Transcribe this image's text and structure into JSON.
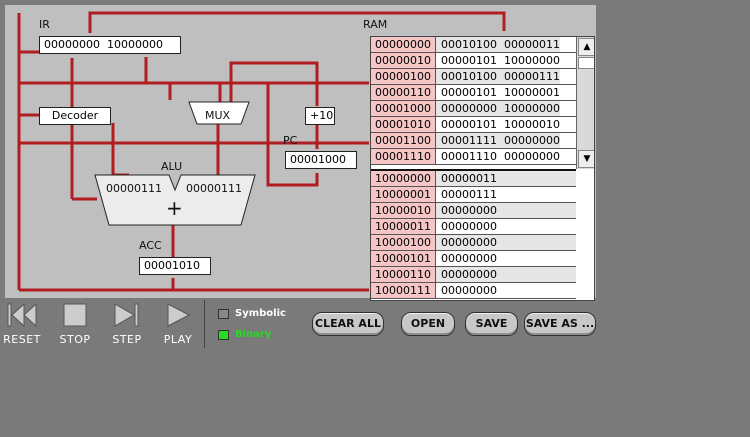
{
  "circuit": {
    "ir_label": "IR",
    "ir_value": "00000000  10000000",
    "ram_label": "RAM",
    "decoder": "Decoder",
    "mux": "MUX",
    "plus10": "+10",
    "pc_label": "PC",
    "pc_value": "00001000",
    "alu_label": "ALU",
    "alu_in1": "00000111",
    "alu_in2": "00000111",
    "alu_op": "+",
    "acc_label": "ACC",
    "acc_value": "00001010"
  },
  "ram": {
    "program_rows": [
      {
        "addr": "00000000",
        "value": "00010100  00000011"
      },
      {
        "addr": "00000010",
        "value": "00000101  10000000"
      },
      {
        "addr": "00000100",
        "value": "00010100  00000111"
      },
      {
        "addr": "00000110",
        "value": "00000101  10000001"
      },
      {
        "addr": "00001000",
        "value": "00000000  10000000"
      },
      {
        "addr": "00001010",
        "value": "00000101  10000010"
      },
      {
        "addr": "00001100",
        "value": "00001111  00000000"
      },
      {
        "addr": "00001110",
        "value": "00001110  00000000"
      }
    ],
    "data_rows": [
      {
        "addr": "10000000",
        "value": "00000011"
      },
      {
        "addr": "10000001",
        "value": "00000111"
      },
      {
        "addr": "10000010",
        "value": "00000000"
      },
      {
        "addr": "10000011",
        "value": "00000000"
      },
      {
        "addr": "10000100",
        "value": "00000000"
      },
      {
        "addr": "10000101",
        "value": "00000000"
      },
      {
        "addr": "10000110",
        "value": "00000000"
      },
      {
        "addr": "10000111",
        "value": "00000000"
      }
    ],
    "scroll_up": "▲",
    "scroll_down": "▼"
  },
  "controls": {
    "reset": "RESET",
    "stop": "STOP",
    "step": "STEP",
    "play": "PLAY"
  },
  "mode": {
    "symbolic": "Symbolic",
    "binary": "Binary",
    "selected": "binary",
    "active_color": "#22dd22",
    "inactive_color": "#ffffff"
  },
  "buttons": {
    "clear_all": "CLEAR ALL",
    "open": "OPEN",
    "save": "SAVE",
    "save_as": "SAVE AS ..."
  },
  "colors": {
    "wire": "#b01e22",
    "ram_address_bg": "#f6c6c6"
  }
}
